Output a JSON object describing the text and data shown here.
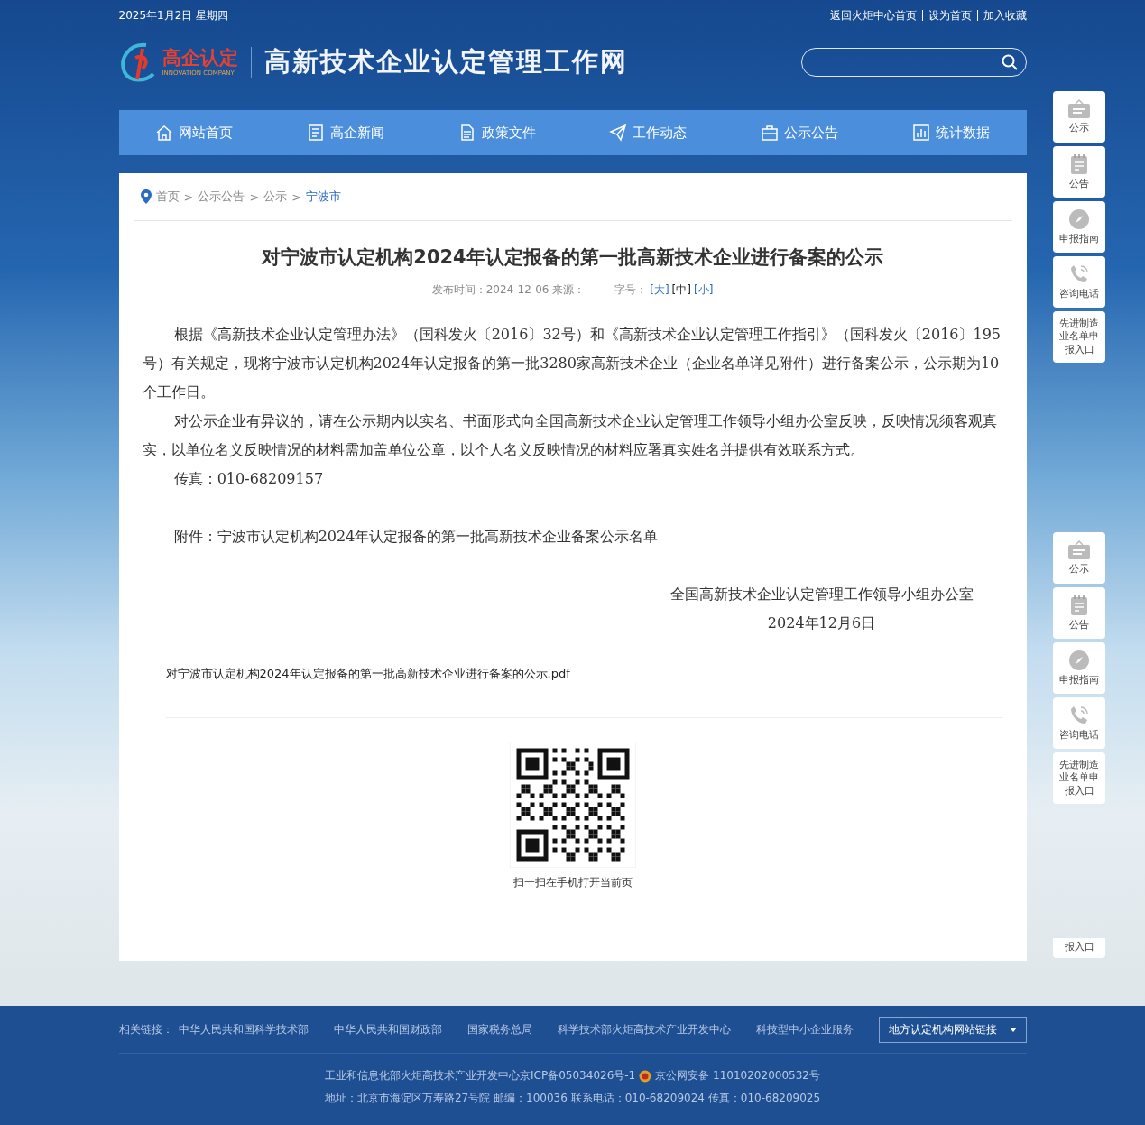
{
  "top_bar": {
    "date": "2025年1月2日 星期四",
    "links": [
      "返回火炬中心首页",
      "设为首页",
      "加入收藏"
    ]
  },
  "logo": {
    "mark_text": "高企认定",
    "mark_subtitle": "INNOVATION COMPANY",
    "site_title": "高新技术企业认定管理工作网"
  },
  "nav": [
    {
      "label": "网站首页"
    },
    {
      "label": "高企新闻"
    },
    {
      "label": "政策文件"
    },
    {
      "label": "工作动态"
    },
    {
      "label": "公示公告"
    },
    {
      "label": "统计数据"
    }
  ],
  "breadcrumb_separator": ">",
  "breadcrumb": [
    {
      "label": "首页",
      "current": false
    },
    {
      "label": "公示公告",
      "current": false
    },
    {
      "label": "公示",
      "current": false
    },
    {
      "label": "宁波市",
      "current": true
    }
  ],
  "article": {
    "title": "对宁波市认定机构2024年认定报备的第一批高新技术企业进行备案的公示",
    "meta": "发布时间：2024-12-06 来源：",
    "font_label": "字号：",
    "font_sizes": [
      {
        "label": "[大]",
        "selected": false
      },
      {
        "label": "[中]",
        "selected": true
      },
      {
        "label": "[小]",
        "selected": false
      }
    ],
    "paragraphs": [
      "根据《高新技术企业认定管理办法》（国科发火〔2016〕32号）和《高新技术企业认定管理工作指引》（国科发火〔2016〕195号）有关规定，现将宁波市认定机构2024年认定报备的第一批3280家高新技术企业（企业名单详见附件）进行备案公示，公示期为10个工作日。",
      "对公示企业有异议的，请在公示期内以实名、书面形式向全国高新技术企业认定管理工作领导小组办公室反映，反映情况须客观真实，以单位名义反映情况的材料需加盖单位公章，以个人名义反映情况的材料应署真实姓名并提供有效联系方式。",
      "传真：010-68209157"
    ],
    "attachment": "附件：宁波市认定机构2024年认定报备的第一批高新技术企业备案公示名单",
    "signature_org": "全国高新技术企业认定管理工作领导小组办公室",
    "signature_date": "2024年12月6日",
    "file_link": "对宁波市认定机构2024年认定报备的第一批高新技术企业进行备案的公示.pdf",
    "qr_caption": "扫一扫在手机打开当前页"
  },
  "side_menu_top": [
    "公示",
    "公告",
    "申报指南",
    "咨询电话",
    "先进制造业名单申报入口"
  ],
  "side_menu_bottom": [
    "公示",
    "公告",
    "申报指南",
    "咨询电话",
    "先进制造业名单申报入口"
  ],
  "side_menu_fragment": "报入口",
  "footer": {
    "links_label": "相关链接：",
    "links": [
      "中华人民共和国科学技术部",
      "中华人民共和国财政部",
      "国家税务总局",
      "科学技术部火炬高技术产业开发中心",
      "科技型中小企业服务"
    ],
    "dropdown": "地方认定机构网站链接",
    "icp": "工业和信息化部火炬高技术产业开发中心京ICP备05034026号-1",
    "police": "京公网安备 11010202000532号",
    "address": "地址：北京市海淀区万寿路27号院 邮编：100036 联系电话：010-68209024 传真：010-68209025"
  }
}
